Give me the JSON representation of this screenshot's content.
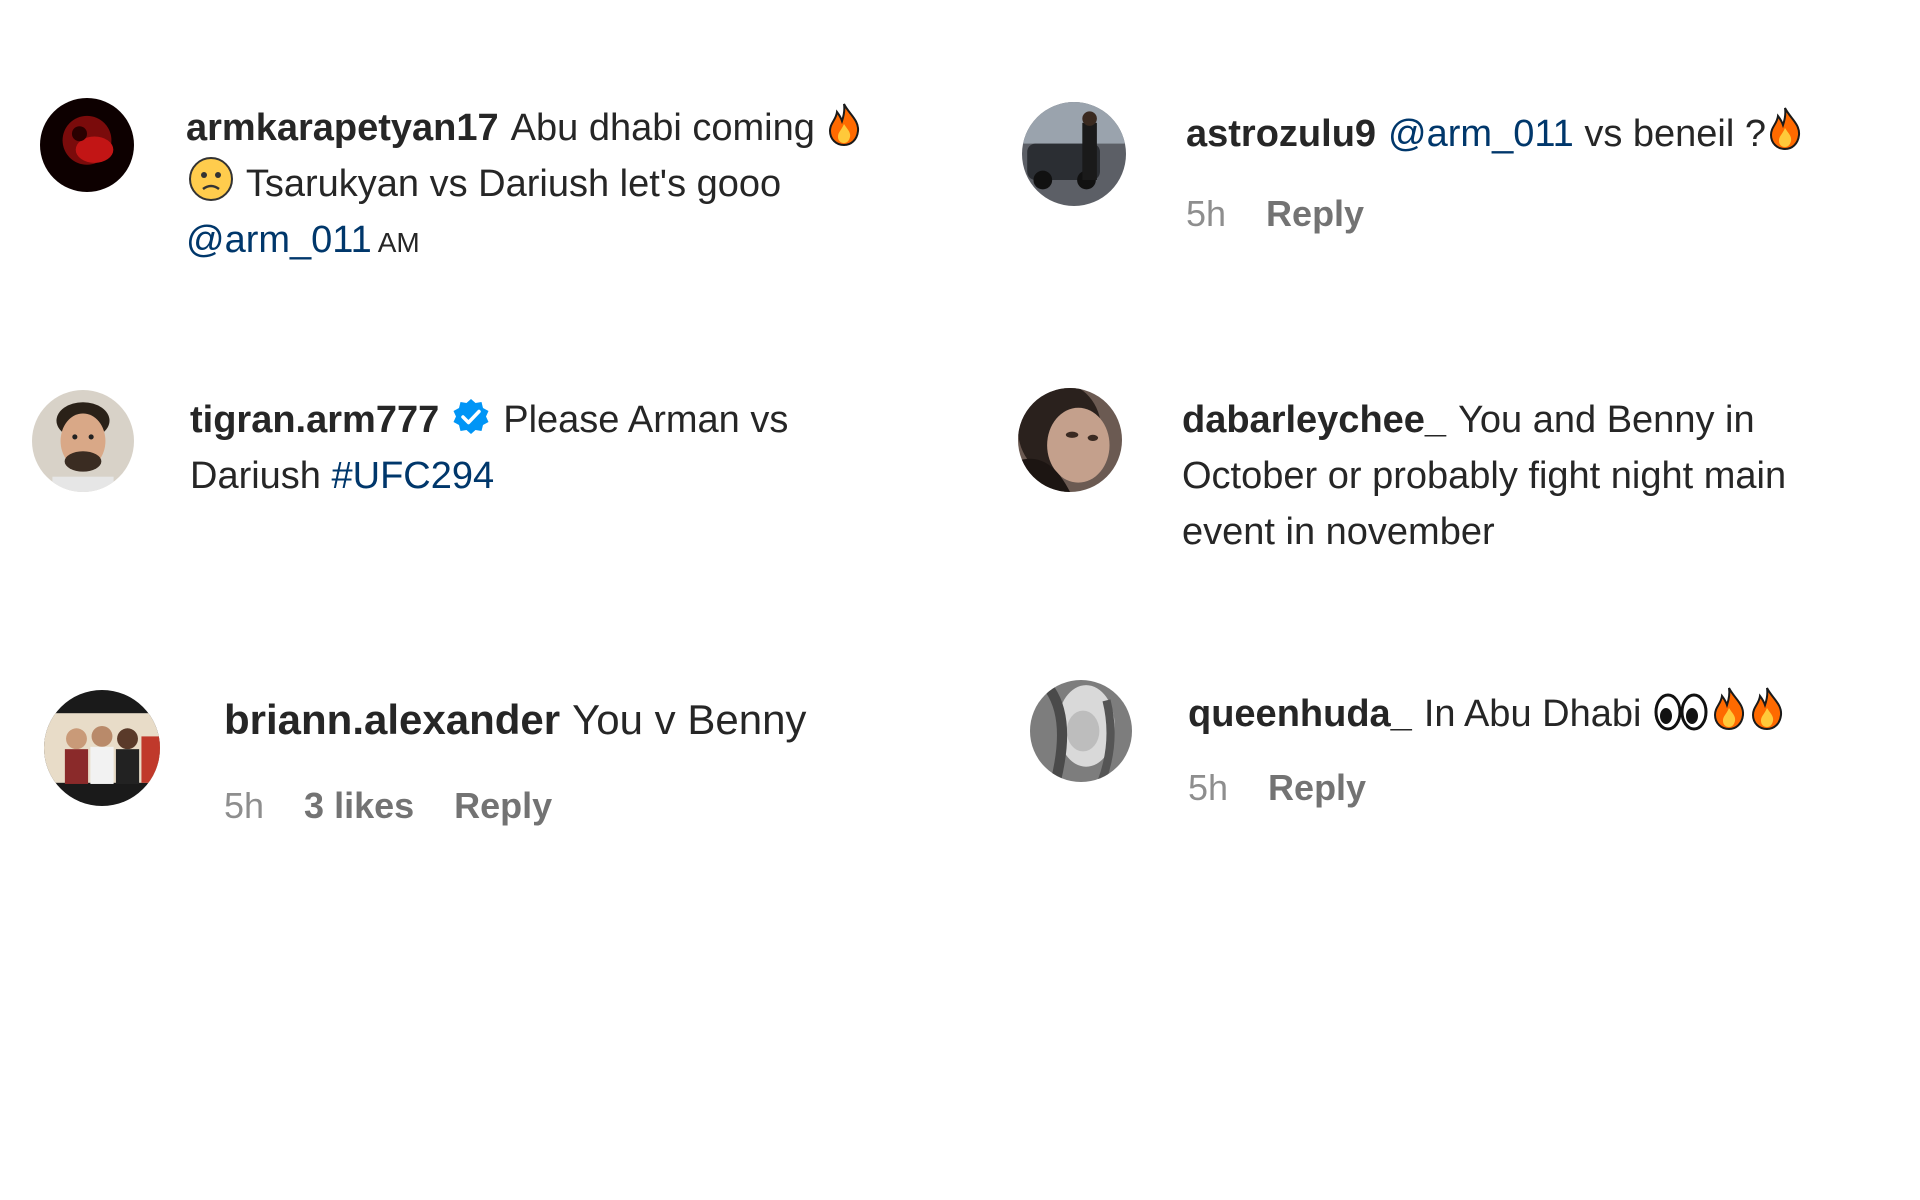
{
  "comments": [
    {
      "username": "armkarapetyan17",
      "text_1": "Abu dhabi coming",
      "text_2": "Tsarukyan vs Dariush let's gooo",
      "mention": "@arm_011",
      "time_suffix": "AM",
      "emojis": [
        "fire-emoji",
        "worried-face-emoji"
      ]
    },
    {
      "username": "astrozulu9",
      "mention": "@arm_011",
      "text_1": "vs beneil ?",
      "time": "5h",
      "reply_label": "Reply",
      "emojis": [
        "fire-emoji"
      ]
    },
    {
      "username": "tigran.arm777",
      "verified": true,
      "text_1": "Please Arman vs",
      "text_2": "Dariush",
      "hashtag": "#UFC294"
    },
    {
      "username": "dabarleychee_",
      "text_1": "You and Benny in October or probably fight night main event in november"
    },
    {
      "username": "briann.alexander",
      "text_1": "You v Benny",
      "time": "5h",
      "likes": "3 likes",
      "reply_label": "Reply"
    },
    {
      "username": "queenhuda_",
      "text_1": "In Abu Dhabi",
      "time": "5h",
      "reply_label": "Reply",
      "emojis": [
        "eyes-emoji",
        "fire-emoji",
        "fire-emoji"
      ]
    }
  ],
  "colors": {
    "text": "#262626",
    "meta": "#8e8e8e",
    "link": "#00376b",
    "verified": "#0095f6",
    "fire": "#ff6a00"
  }
}
